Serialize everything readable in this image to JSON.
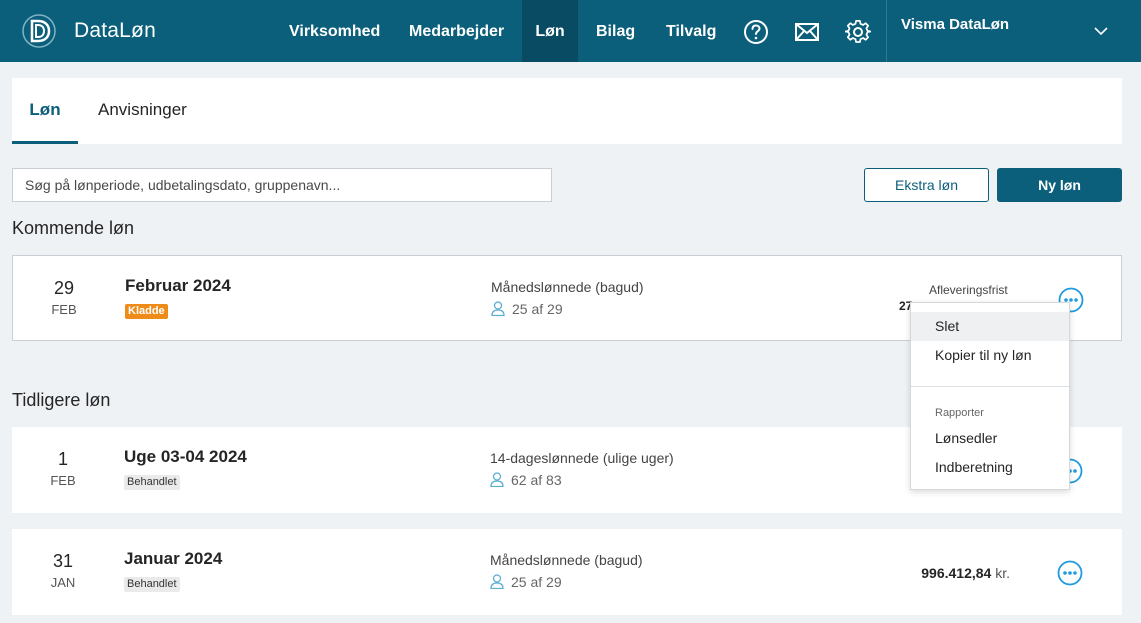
{
  "topbar": {
    "brand": "DataLøn",
    "nav": [
      {
        "label": "Virksomhed",
        "active": false
      },
      {
        "label": "Medarbejder",
        "active": false
      },
      {
        "label": "Løn",
        "active": true
      },
      {
        "label": "Bilag",
        "active": false
      },
      {
        "label": "Tilvalg",
        "active": false
      }
    ],
    "icons": [
      "help-icon",
      "mail-icon",
      "gear-icon"
    ],
    "company": "Visma DataLøn",
    "colors": {
      "bar": "#0b5f7b",
      "active": "#084b62"
    }
  },
  "tabs": [
    {
      "label": "Løn",
      "active": true
    },
    {
      "label": "Anvisninger",
      "active": false
    }
  ],
  "search": {
    "placeholder": "Søg på lønperiode, udbetalingsdato, gruppenavn...",
    "value": ""
  },
  "buttons": {
    "extra": "Ekstra løn",
    "new": "Ny løn"
  },
  "sections": {
    "upcoming": "Kommende løn",
    "previous": "Tidligere løn"
  },
  "upcoming": [
    {
      "day": "29",
      "month": "FEB",
      "title": "Februar 2024",
      "status": "Kladde",
      "group": "Månedslønnede (bagud)",
      "count": "25 af 29",
      "deadline_label": "Afleveringsfrist",
      "deadline_value": "27"
    }
  ],
  "previous": [
    {
      "day": "1",
      "month": "FEB",
      "title": "Uge 03-04 2024",
      "status": "Behandlet",
      "group": "14-dageslønnede (ulige uger)",
      "count": "62 af 83"
    },
    {
      "day": "31",
      "month": "JAN",
      "title": "Januar 2024",
      "status": "Behandlet",
      "group": "Månedslønnede (bagud)",
      "count": "25 af 29",
      "amount": "996.412,84",
      "currency": "kr."
    }
  ],
  "menu": {
    "items": [
      "Slet",
      "Kopier til ny løn"
    ],
    "heading": "Rapporter",
    "report_items": [
      "Lønsedler",
      "Indberetning"
    ]
  },
  "status_colors": {
    "draft": "#ef8b19",
    "done": "#eaeaea"
  }
}
